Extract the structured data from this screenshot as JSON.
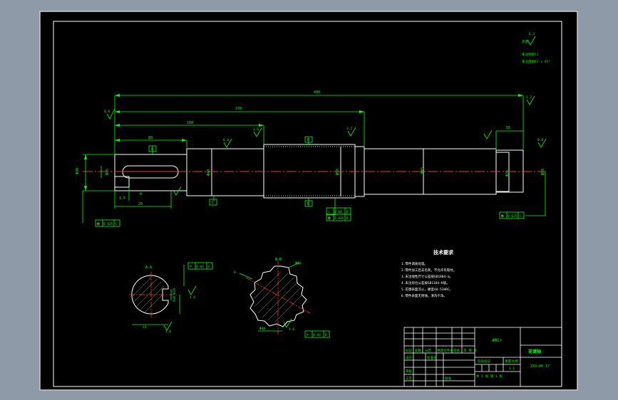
{
  "dims": {
    "overall_length": "400",
    "len_a": "270",
    "len_b": "180",
    "len_c": "80",
    "left_end": "20",
    "right_end": "55",
    "keyseat_w": "8",
    "keyseat_small": "1.5"
  },
  "diameters": {
    "left_journal": "Φ35",
    "shoulder": "Φ40",
    "collar": "Φ48",
    "spline_body": "Φ50",
    "right_seat": "Φ45",
    "right_end": "Φ35",
    "spline_label": "Φ48",
    "right_section": "Φ50",
    "left_extent": "Φ30"
  },
  "roughness": {
    "top_general": "6.3",
    "top_left": "0.8",
    "mid": "1.6",
    "right_top": "3.2",
    "spline": "0.8",
    "section_left": "1.6",
    "section_left_b": "1.6",
    "section_right": "1.6",
    "right_end": "0.8",
    "spline_tip": "3.2"
  },
  "notes_top_right": {
    "line1": "未注倒角C1",
    "line2": "未注圆角R1 x 45°",
    "line3": "其余"
  },
  "datums": {
    "a": "A",
    "b": "B",
    "c": "C",
    "d": "D"
  },
  "tolerance_frames": {
    "left": [
      "◎",
      "0.025",
      "C"
    ],
    "right": [
      "◎",
      "0.025",
      "C"
    ],
    "spline_top": [
      "∠",
      "0.04",
      "B"
    ],
    "spline_bot": [
      "◎",
      "0.025",
      "B"
    ],
    "sec1": [
      "=",
      "0.03",
      "C"
    ],
    "sec2": [
      "=",
      "0.03",
      "B"
    ]
  },
  "sections": {
    "a_label": "A-A",
    "b_label": "B-B",
    "a_width": "8±0.018",
    "a_depth": "31",
    "b_dia": "Φ46",
    "b_small": "8"
  },
  "tech_requirements": {
    "title": "技术要求",
    "items": [
      "1.零件调质处理。",
      "2.零件加工后去毛刺，不允许有裂纹。",
      "3.未注线性尺寸公差按GB1804-m。",
      "4.未注形位公差按GB1184-K级。",
      "5.花键表面淬火，硬度48-52HRC。",
      "6.零件表面无锈蚀，清洗干净。"
    ]
  },
  "title_block": {
    "material": "40Cr",
    "part_name": "花键轴",
    "drawing_no": "ZX3-00-17",
    "scale": "1:1",
    "sheet": "共 1 张  第 1 张",
    "row_labels": [
      "标记",
      "处数",
      "分区",
      "更改文件号",
      "签名",
      "年 月 日"
    ],
    "roles": [
      "设计",
      "审核",
      "工艺",
      "标准化",
      "批准"
    ],
    "stage_label": "阶段标记",
    "weight_label": "重量",
    "scale_label": "比例"
  }
}
